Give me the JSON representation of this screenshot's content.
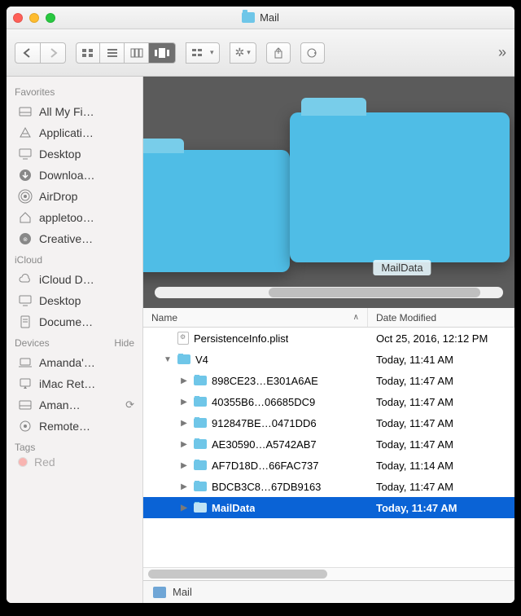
{
  "window": {
    "title": "Mail"
  },
  "sidebar": {
    "sections": [
      {
        "header": "Favorites",
        "hide": "",
        "items": [
          {
            "label": "All My Fi…",
            "icon": "disk"
          },
          {
            "label": "Applicati…",
            "icon": "app"
          },
          {
            "label": "Desktop",
            "icon": "desktop"
          },
          {
            "label": "Downloa…",
            "icon": "download"
          },
          {
            "label": "AirDrop",
            "icon": "airdrop"
          },
          {
            "label": "appletoo…",
            "icon": "home"
          },
          {
            "label": "Creative…",
            "icon": "cc"
          }
        ]
      },
      {
        "header": "iCloud",
        "hide": "",
        "items": [
          {
            "label": "iCloud D…",
            "icon": "cloud"
          },
          {
            "label": "Desktop",
            "icon": "desktop"
          },
          {
            "label": "Docume…",
            "icon": "doc"
          }
        ]
      },
      {
        "header": "Devices",
        "hide": "Hide",
        "items": [
          {
            "label": "Amanda'…",
            "icon": "laptop"
          },
          {
            "label": "iMac Ret…",
            "icon": "imac"
          },
          {
            "label": "Aman…",
            "icon": "disk",
            "sync": true
          },
          {
            "label": "Remote…",
            "icon": "remote"
          }
        ]
      },
      {
        "header": "Tags",
        "hide": "",
        "items": [
          {
            "label": "Red",
            "icon": "tag",
            "color": "#ff5a52",
            "partial": true
          }
        ]
      }
    ]
  },
  "coverflow": {
    "label": "MailData"
  },
  "listHeader": {
    "name": "Name",
    "date": "Date Modified",
    "sort_asc": true
  },
  "files": [
    {
      "indent": 0,
      "disclosure": "",
      "kind": "file",
      "name": "PersistenceInfo.plist",
      "date": "Oct 25, 2016, 12:12 PM"
    },
    {
      "indent": 0,
      "disclosure": "▼",
      "kind": "folder",
      "name": "V4",
      "date": "Today, 11:41 AM"
    },
    {
      "indent": 1,
      "disclosure": "▶",
      "kind": "folder",
      "name": "898CE23…E301A6AE",
      "date": "Today, 11:47 AM"
    },
    {
      "indent": 1,
      "disclosure": "▶",
      "kind": "folder",
      "name": "40355B6…06685DC9",
      "date": "Today, 11:47 AM"
    },
    {
      "indent": 1,
      "disclosure": "▶",
      "kind": "folder",
      "name": "912847BE…0471DD6",
      "date": "Today, 11:47 AM"
    },
    {
      "indent": 1,
      "disclosure": "▶",
      "kind": "folder",
      "name": "AE30590…A5742AB7",
      "date": "Today, 11:47 AM"
    },
    {
      "indent": 1,
      "disclosure": "▶",
      "kind": "folder",
      "name": "AF7D18D…66FAC737",
      "date": "Today, 11:14 AM"
    },
    {
      "indent": 1,
      "disclosure": "▶",
      "kind": "folder",
      "name": "BDCB3C8…67DB9163",
      "date": "Today, 11:47 AM"
    },
    {
      "indent": 1,
      "disclosure": "▶",
      "kind": "folder",
      "name": "MailData",
      "date": "Today, 11:47 AM",
      "selected": true
    }
  ],
  "pathbar": {
    "label": "Mail"
  }
}
